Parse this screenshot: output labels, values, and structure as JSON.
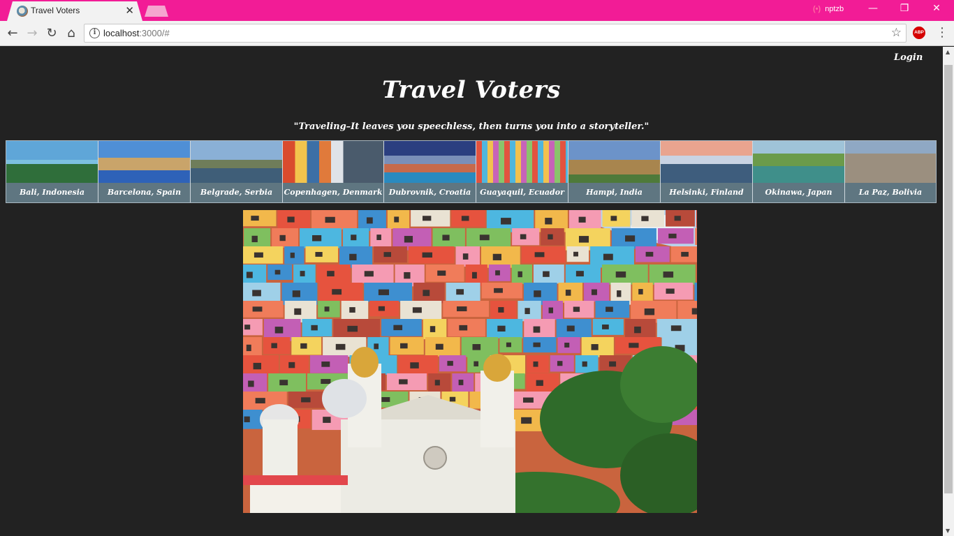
{
  "browser": {
    "tab_title": "Travel Voters",
    "url_host": "localhost",
    "url_rest": ":3000/#",
    "profile_name": "nptzb",
    "accent_color": "#f21c96"
  },
  "site": {
    "login_label": "Login",
    "title": "Travel Voters",
    "quote": "\"Traveling–It leaves you speechless, then turns you into a storyteller.\""
  },
  "destinations": [
    {
      "name": "Bali, Indonesia"
    },
    {
      "name": "Barcelona, Spain"
    },
    {
      "name": "Belgrade, Serbia"
    },
    {
      "name": "Copenhagen, Denmark"
    },
    {
      "name": "Dubrovnik, Croatia"
    },
    {
      "name": "Guayaquil, Ecuador"
    },
    {
      "name": "Hampi, India"
    },
    {
      "name": "Helsinki, Finland"
    },
    {
      "name": "Okinawa, Japan"
    },
    {
      "name": "La Paz, Bolivia"
    }
  ],
  "icons": {
    "favicon": "travel-favicon-icon",
    "close": "close-icon",
    "back": "back-arrow-icon",
    "forward": "forward-arrow-icon",
    "reload": "reload-icon",
    "home": "home-icon",
    "info": "info-icon",
    "star": "star-icon",
    "adblock": "adblock-icon",
    "menu": "kebab-menu-icon"
  },
  "adblock_label": "ABP"
}
